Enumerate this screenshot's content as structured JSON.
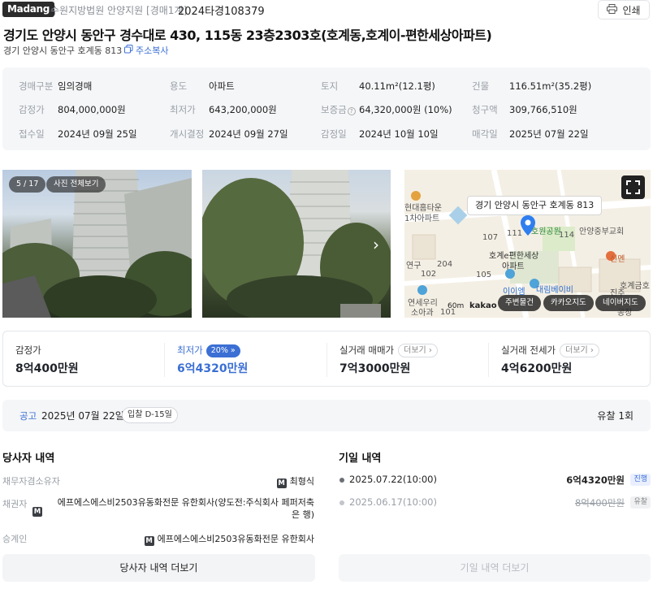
{
  "header": {
    "brand": "Madang",
    "court_name": "수원지방법원 안양지원 [경매1계]",
    "case_number": "2024타경108379",
    "print_label": "인쇄"
  },
  "address": {
    "full": "경기도 안양시 동안구 경수대로 430, 115동 23층2303호(호계동,호계이-편한세상아파트)",
    "short": "경기 안양시 동안구 호계동 813",
    "copy_label": "주소복사"
  },
  "summary": {
    "auction_type_label": "경매구분",
    "auction_type": "임의경매",
    "use_label": "용도",
    "use": "아파트",
    "land_label": "토지",
    "land": "40.11m²(12.1평)",
    "building_label": "건물",
    "building": "116.51m²(35.2평)",
    "appraised_label": "감정가",
    "appraised": "804,000,000원",
    "min_price_label": "최저가",
    "min_price": "643,200,000원",
    "deposit_label": "보증금",
    "deposit": "64,320,000원 (10%)",
    "claim_label": "청구액",
    "claim": "309,766,510원",
    "received_label": "접수일",
    "received": "2024년 09월 25일",
    "started_label": "개시결정",
    "started": "2024년 09월 27일",
    "appraisal_date_label": "감정일",
    "appraisal_date": "2024년 10월 10일",
    "sale_date_label": "매각일",
    "sale_date": "2025년 07월 22일"
  },
  "photos": {
    "counter": "5 / 17",
    "view_all_label": "사진 전체보기"
  },
  "map": {
    "tooltip": "경기 안양시 동안구 호계동 813",
    "labels": [
      "현대홈타운",
      "1차아파트",
      "110",
      "호원공원",
      "안양중부교회",
      "111",
      "114",
      "107",
      "호계e편한세상",
      "아파트",
      "204",
      "105",
      "102",
      "신멘",
      "호계금호",
      "이이엠",
      "대림베이비",
      "진주",
      "연세우리",
      "소아과",
      "101",
      "연구",
      "공장",
      "60m",
      "kakao"
    ],
    "btn_nearby": "주변물건",
    "btn_kakao": "카카오지도",
    "btn_naver": "네이버지도"
  },
  "prices": {
    "appraised_label": "감정가",
    "appraised": "8억400만원",
    "min_label": "최저가",
    "min_pct": "20%",
    "min": "6억4320만원",
    "trade_label": "실거래 매매가",
    "trade": "7억3000만원",
    "jeonse_label": "실거래 전세가",
    "jeonse": "4억6200만원",
    "more_label": "더보기"
  },
  "notice": {
    "label": "공고",
    "date": "2025년 07월 22일",
    "dday": "입찰 D-15일",
    "fail_count": "유찰 1회"
  },
  "parties": {
    "title": "당사자 내역",
    "rows": [
      {
        "key": "채무자겸소유자",
        "value": "최형식"
      },
      {
        "key": "채권자",
        "value": "에프에스에스비2503유동화전문 유한회사(양도전:주식회사 페퍼저축은 행)"
      },
      {
        "key": "승계인",
        "value": "에프에스에스비2503유동화전문 유한회사"
      }
    ],
    "more_button": "당사자 내역 더보기"
  },
  "history": {
    "title": "기일 내역",
    "rows": [
      {
        "date": "2025.07.22(10:00)",
        "price": "6억4320만원",
        "status": "진행"
      },
      {
        "date": "2025.06.17(10:00)",
        "price": "8억400만원",
        "status": "유찰"
      }
    ],
    "more_button": "기일 내역 더보기"
  },
  "colors": {
    "accent": "#3b6fd4",
    "text_main": "#1f2329",
    "muted": "#9aa0a7",
    "panel_bg": "#f5f6f8"
  }
}
